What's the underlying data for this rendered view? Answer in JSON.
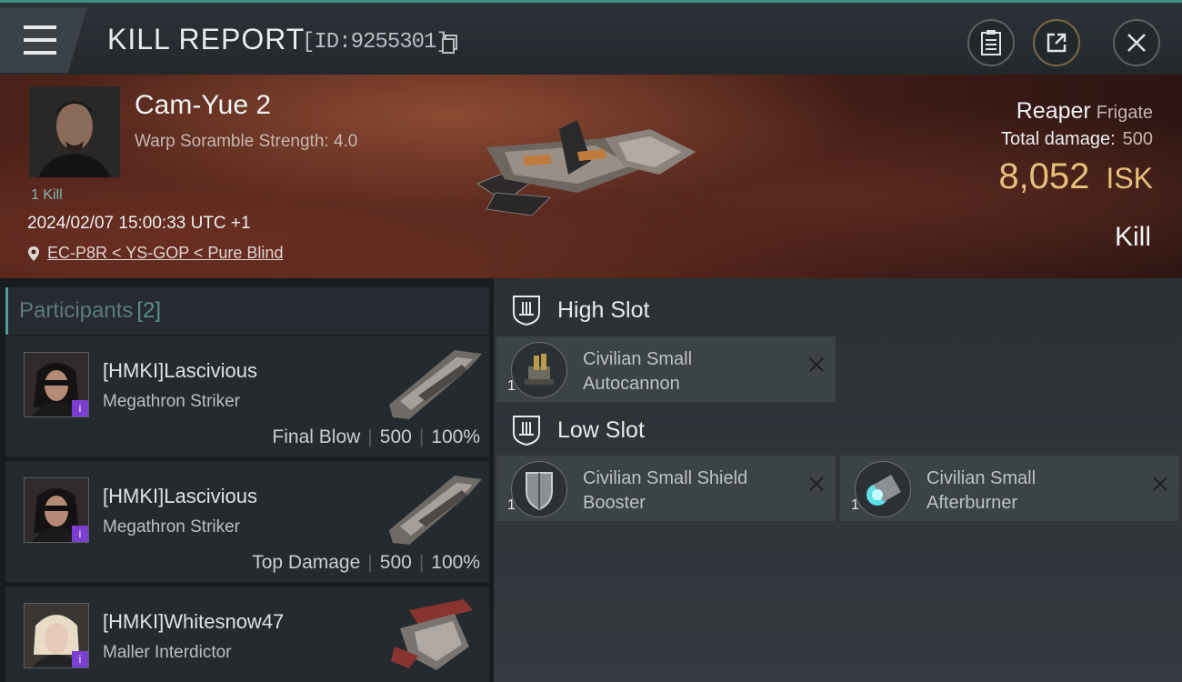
{
  "header": {
    "title": "KILL REPORT",
    "report_id": "[ID:9255301]",
    "buttons": [
      "clipboard-icon",
      "share-icon",
      "close-icon"
    ]
  },
  "victim": {
    "name": "Cam-Yue 2",
    "subtitle": "Warp Soramble Strength: 4.0",
    "kill_count": "1 Kill",
    "datetime": "2024/02/07 15:00:33 UTC +1",
    "location": "EC-P8R < YS-GOP < Pure Blind",
    "ship": "Reaper",
    "ship_class": "Frigate",
    "total_damage_label": "Total damage:",
    "total_damage": "500",
    "isk_value": "8,052",
    "isk_unit": "ISK",
    "result": "Kill"
  },
  "participants": {
    "label": "Participants",
    "count": "[2]",
    "rows": [
      {
        "name": "[HMKI]Lascivious",
        "ship": "Megathron Striker",
        "tag": "Final Blow",
        "damage": "500",
        "percent": "100%"
      },
      {
        "name": "[HMKI]Lascivious",
        "ship": "Megathron Striker",
        "tag": "Top Damage",
        "damage": "500",
        "percent": "100%"
      },
      {
        "name": "[HMKI]Whitesnow47",
        "ship": "Maller Interdictor"
      }
    ]
  },
  "fitting": {
    "high_slot": {
      "label": "High Slot",
      "modules": [
        {
          "name": "Civilian Small Autocannon",
          "qty": "1"
        }
      ]
    },
    "low_slot": {
      "label": "Low Slot",
      "modules": [
        {
          "name": "Civilian Small Shield Booster",
          "qty": "1"
        },
        {
          "name": "Civilian Small Afterburner",
          "qty": "1"
        }
      ]
    }
  },
  "colors": {
    "accent": "#4d9d96",
    "isk": "#e6bf7a",
    "badge": "#7a3fd0"
  }
}
